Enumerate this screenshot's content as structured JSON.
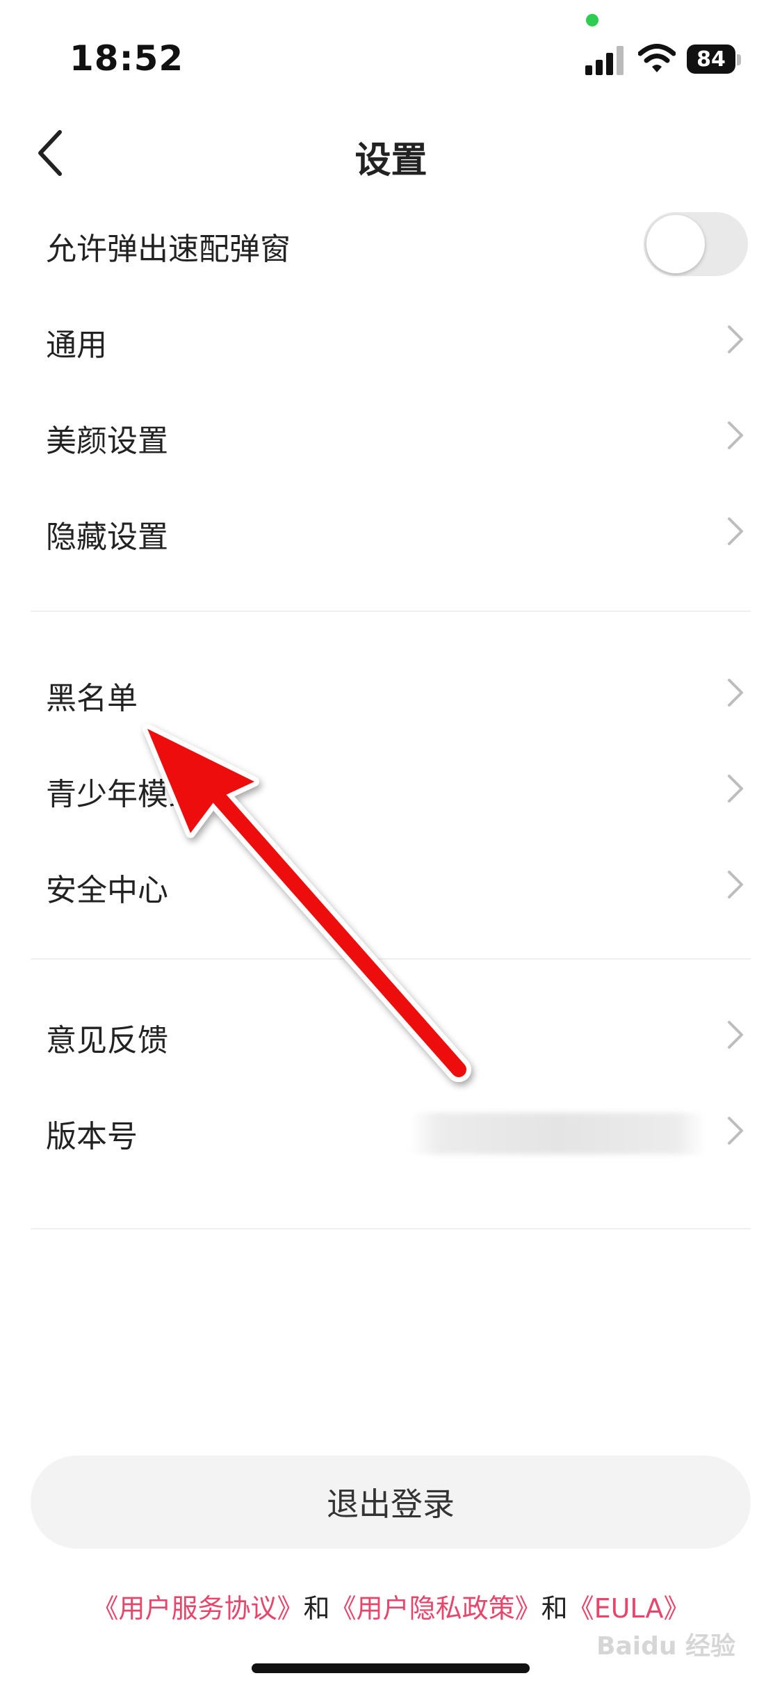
{
  "status_bar": {
    "time": "18:52",
    "battery": "84"
  },
  "nav": {
    "title": "设置"
  },
  "settings": {
    "popup_toggle_label": "允许弹出速配弹窗",
    "popup_toggle_on": false,
    "group1": [
      {
        "label": "通用"
      },
      {
        "label": "美颜设置"
      },
      {
        "label": "隐藏设置"
      }
    ],
    "group2": [
      {
        "label": "黑名单"
      },
      {
        "label": "青少年模式"
      },
      {
        "label": "安全中心"
      }
    ],
    "group3": [
      {
        "label": "意见反馈"
      },
      {
        "label": "版本号"
      }
    ]
  },
  "logout_label": "退出登录",
  "footer": {
    "user_agreement": "《用户服务协议》",
    "and1": "和",
    "privacy_policy": "《用户隐私政策》",
    "and2": "和",
    "eula": "《EULA》"
  },
  "watermark": "Baidu 经验",
  "colors": {
    "link": "#e8456b",
    "arrow": "#ee1111",
    "toggle_off": "#e9e9ea"
  },
  "icons": [
    "back-chevron-icon",
    "chevron-right-icon",
    "signal-icon",
    "wifi-icon",
    "battery-icon"
  ]
}
